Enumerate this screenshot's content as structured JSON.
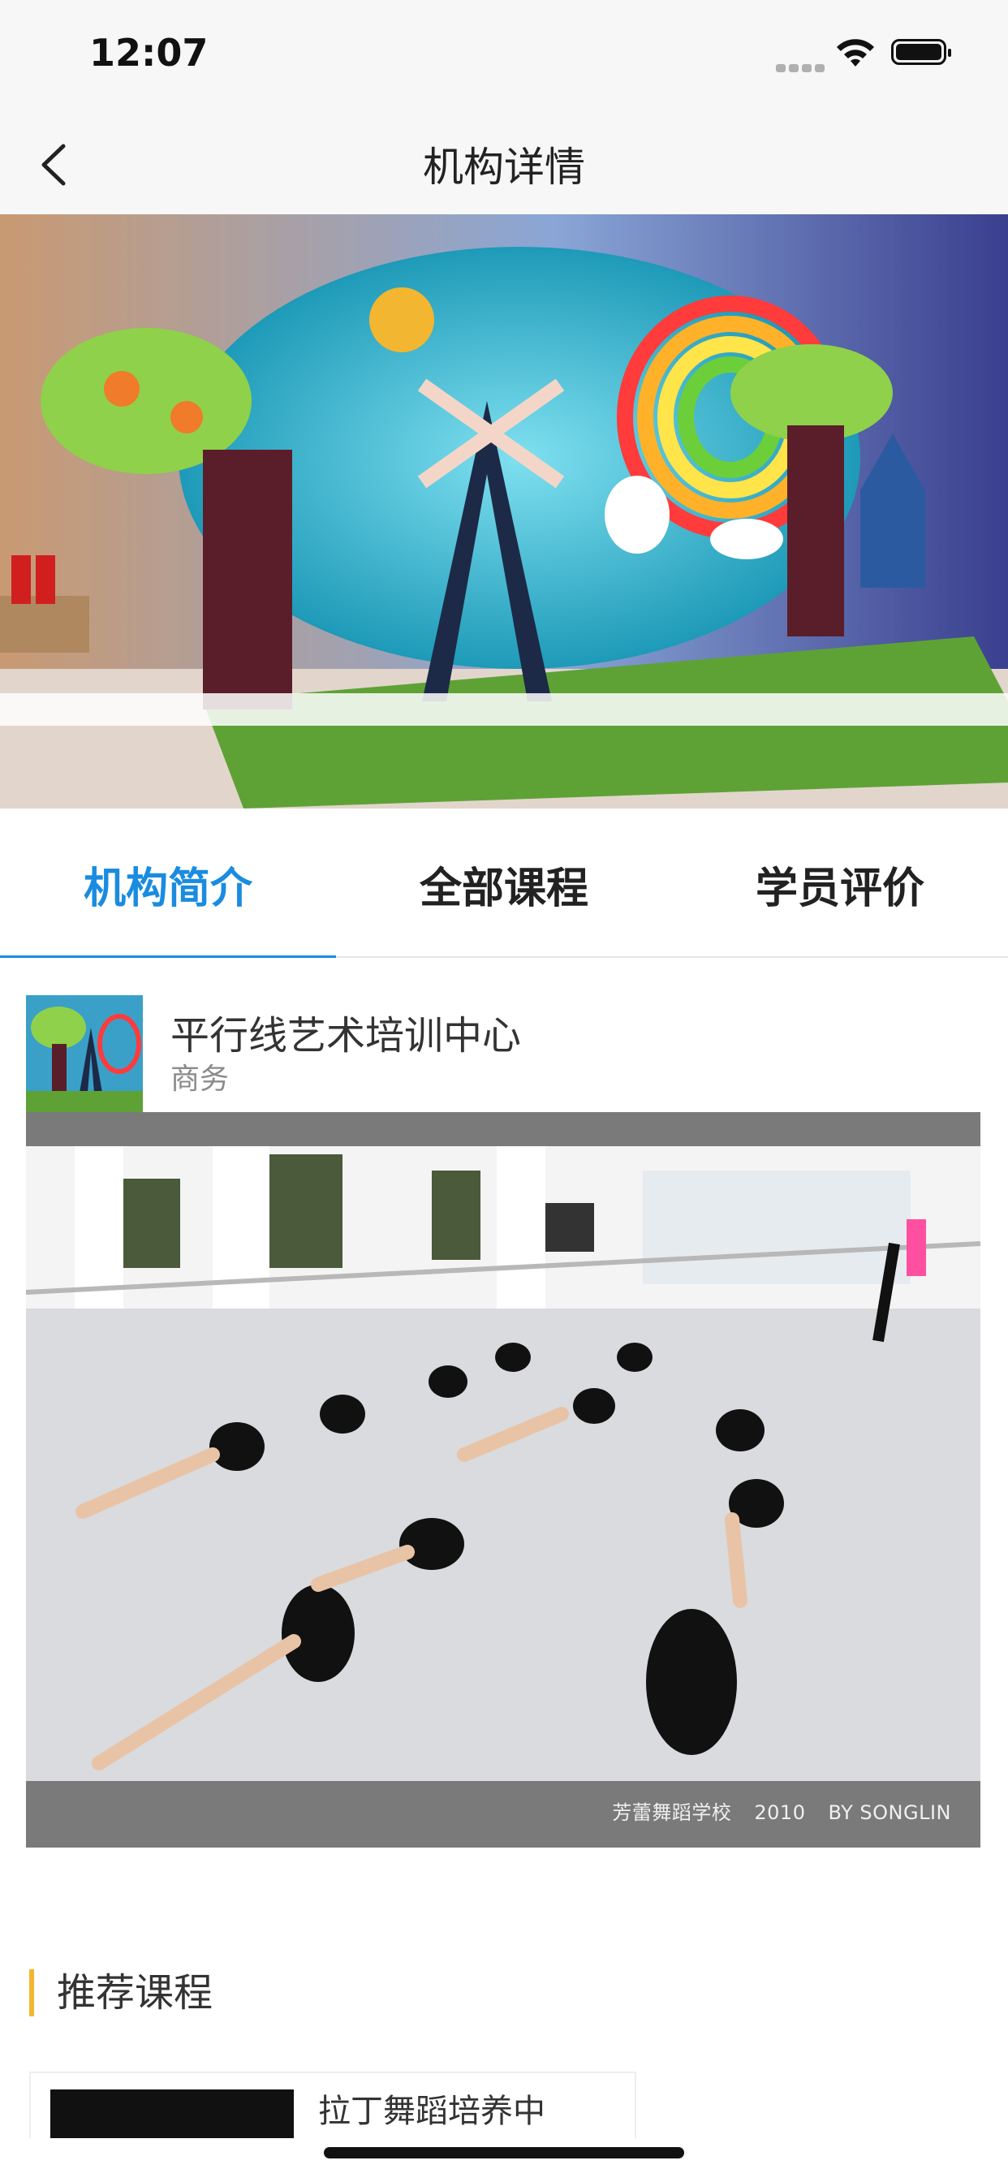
{
  "status_bar": {
    "time": "12:07"
  },
  "nav": {
    "title": "机构详情"
  },
  "tabs": [
    {
      "label": "机构简介",
      "active": true
    },
    {
      "label": "全部课程",
      "active": false
    },
    {
      "label": "学员评价",
      "active": false
    }
  ],
  "org": {
    "name": "平行线艺术培训中心",
    "category": "商务"
  },
  "feature": {
    "caption_school": "芳蕾舞蹈学校",
    "caption_year": "2010",
    "caption_by": "BY SONGLIN"
  },
  "section": {
    "title": "推荐课程"
  },
  "course": {
    "title": "拉丁舞蹈培养中"
  },
  "colors": {
    "accent": "#1a8ce0",
    "section_bar": "#f2b630"
  }
}
